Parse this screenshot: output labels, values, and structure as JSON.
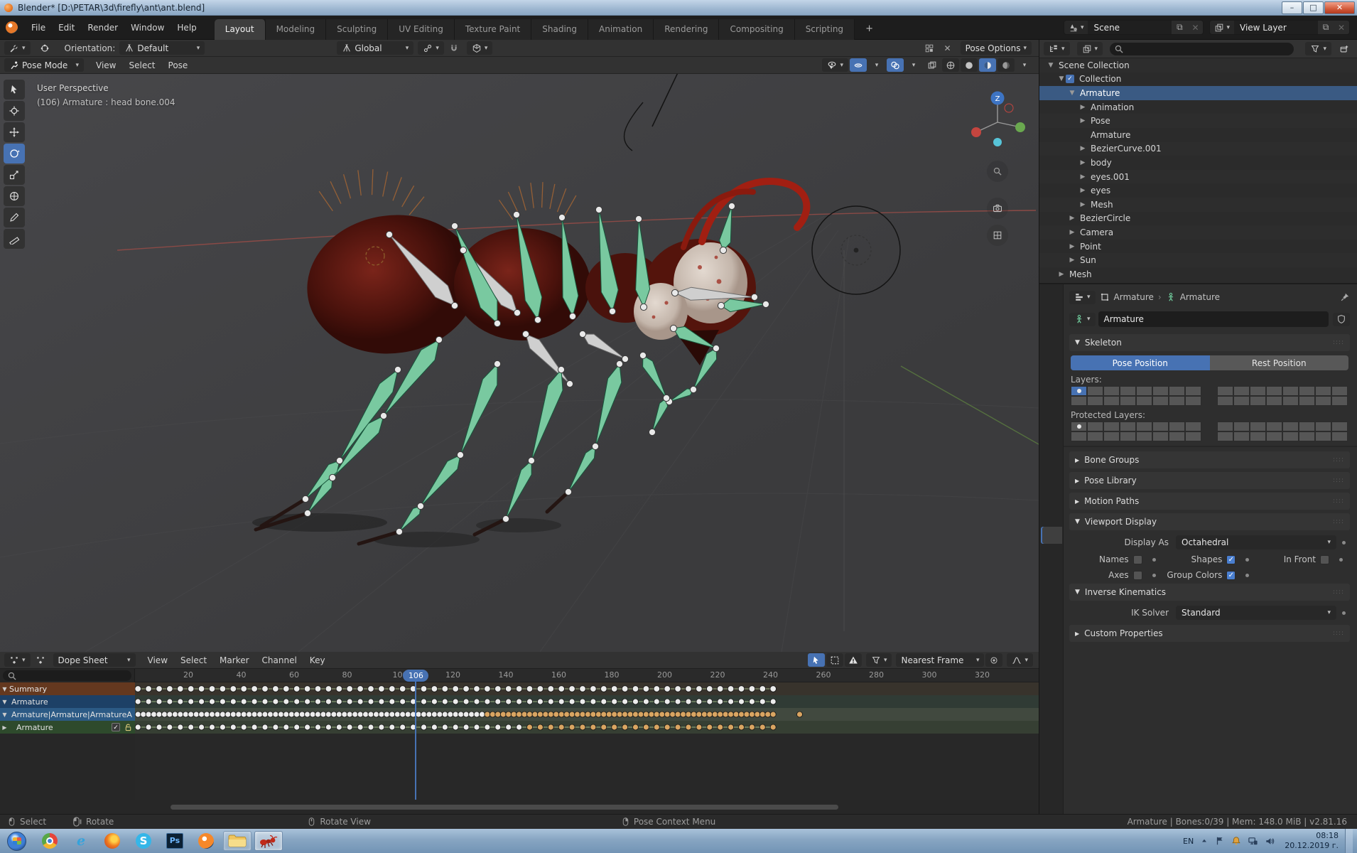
{
  "window": {
    "title": "Blender* [D:\\PETAR\\3d\\firefly\\ant\\ant.blend]"
  },
  "topbar": {
    "menus": [
      "File",
      "Edit",
      "Render",
      "Window",
      "Help"
    ],
    "tabs": [
      {
        "label": "Layout",
        "active": true
      },
      {
        "label": "Modeling"
      },
      {
        "label": "Sculpting"
      },
      {
        "label": "UV Editing"
      },
      {
        "label": "Texture Paint"
      },
      {
        "label": "Shading"
      },
      {
        "label": "Animation"
      },
      {
        "label": "Rendering"
      },
      {
        "label": "Compositing"
      },
      {
        "label": "Scripting"
      }
    ],
    "new_workspace_label": "+",
    "scene_selector": "Scene",
    "view_layer_selector": "View Layer"
  },
  "tool_settings": {
    "orientation_label": "Orientation:",
    "orientation_value": "Default",
    "transform_space": "Global",
    "mode_options_label": "Pose Options"
  },
  "viewport": {
    "mode": "Pose Mode",
    "menus": [
      "View",
      "Select",
      "Pose"
    ],
    "overlay_line1": "User Perspective",
    "overlay_line2": "(106) Armature : head bone.004",
    "gizmo_axis_label": "Z"
  },
  "outliner": {
    "rows": [
      {
        "label": "Scene Collection",
        "depth": 0,
        "icon": "collection",
        "expander": "open"
      },
      {
        "label": "Collection",
        "depth": 1,
        "icon": "collection",
        "checkbox": true,
        "expander": "open",
        "vis": true
      },
      {
        "label": "Armature",
        "depth": 2,
        "icon": "armature-object",
        "selected": true,
        "expander": "open",
        "vis": true
      },
      {
        "label": "Animation",
        "depth": 3,
        "icon": "animation",
        "extra": [
          "action"
        ],
        "expander": "closed"
      },
      {
        "label": "Pose",
        "depth": 3,
        "icon": "pose",
        "extra": [
          "bone"
        ],
        "expander": "closed"
      },
      {
        "label": "Armature",
        "depth": 3,
        "icon": "armature-data"
      },
      {
        "label": "BezierCurve.001",
        "depth": 3,
        "icon": "curve-object",
        "extra": [
          "wrench",
          "material",
          "triangulate"
        ],
        "expander": "closed",
        "vis": true
      },
      {
        "label": "body",
        "depth": 3,
        "icon": "curve-object",
        "extra": [
          "wrench",
          "material",
          "triangulate"
        ],
        "expander": "closed",
        "vis": true
      },
      {
        "label": "eyes.001",
        "depth": 3,
        "icon": "curve-object",
        "extra": [
          "wrench",
          "material",
          "triangulate"
        ],
        "expander": "closed",
        "vis": true
      },
      {
        "label": "eyes",
        "depth": 3,
        "icon": "curve-object",
        "extra": [
          "wrench",
          "material",
          "triangulate"
        ],
        "expander": "closed",
        "vis": true
      },
      {
        "label": "Mesh",
        "depth": 3,
        "icon": "curve-object",
        "extra": [
          "wrench",
          "material",
          "triangulate"
        ],
        "expander": "closed",
        "vis": true
      },
      {
        "label": "BezierCircle",
        "depth": 2,
        "icon": "curve-circle",
        "extra": [
          "bezier-data"
        ],
        "expander": "closed",
        "vis": true
      },
      {
        "label": "Camera",
        "depth": 2,
        "icon": "camera-object",
        "extra": [
          "camera-data"
        ],
        "expander": "closed",
        "vis": true
      },
      {
        "label": "Point",
        "depth": 2,
        "icon": "light-object",
        "extra": [
          "light-point"
        ],
        "expander": "closed",
        "vis": true
      },
      {
        "label": "Sun",
        "depth": 2,
        "icon": "light-object",
        "extra": [
          "sun-data"
        ],
        "expander": "closed",
        "vis": true
      },
      {
        "label": "Mesh",
        "depth": 1,
        "icon": "curve-object",
        "extra": [
          "wrench",
          "material",
          "triangulate"
        ],
        "expander": "closed",
        "vis": true
      }
    ]
  },
  "properties": {
    "tabs": [
      "tool",
      "render",
      "output",
      "view-layer",
      "scene",
      "world",
      "object",
      "constraints",
      "physics",
      "object-data",
      "bone",
      "modifier",
      "texture"
    ],
    "active_tab": "object-data",
    "breadcrumb_1": "Armature",
    "breadcrumb_2": "Armature",
    "name_value": "Armature",
    "skeleton": {
      "title": "Skeleton",
      "pose_button": "Pose Position",
      "rest_button": "Rest Position",
      "layers_label": "Layers:",
      "protected_label": "Protected Layers:"
    },
    "collapsed_sections": [
      "Bone Groups",
      "Pose Library",
      "Motion Paths"
    ],
    "viewport_display": {
      "title": "Viewport Display",
      "display_as_label": "Display As",
      "display_as_value": "Octahedral",
      "toggles": [
        {
          "label": "Names",
          "checked": false
        },
        {
          "label": "Shapes",
          "checked": true
        },
        {
          "label": "In Front",
          "checked": false
        },
        {
          "label": "Axes",
          "checked": false
        },
        {
          "label": "Group Colors",
          "checked": true
        }
      ]
    },
    "inverse_kinematics": {
      "title": "Inverse Kinematics",
      "solver_label": "IK Solver",
      "solver_value": "Standard"
    },
    "custom_properties_title": "Custom Properties"
  },
  "dopesheet": {
    "editor_label": "Dope Sheet",
    "menus": [
      "View",
      "Select",
      "Marker",
      "Channel",
      "Key"
    ],
    "snap_value": "Nearest Frame",
    "current_frame": 106,
    "ruler_ticks": [
      20,
      40,
      60,
      80,
      100,
      120,
      140,
      160,
      180,
      200,
      220,
      240,
      260,
      280,
      300,
      320
    ],
    "channels": [
      {
        "label": "Summary",
        "color": "#64381f",
        "band": "#38332c",
        "expander": "open",
        "keys": {
          "from": 1,
          "to": 241,
          "step": 4
        }
      },
      {
        "label": "Armature",
        "color": "#1d4066",
        "band": "#303b35",
        "icon": "armature-data-w",
        "expander": "open",
        "keys": {
          "from": 1,
          "to": 241,
          "step": 4
        }
      },
      {
        "label": "Armature|Armature|ArmatureA",
        "color": "#2c5a85",
        "band": "#41493f",
        "icon": "action",
        "expander": "open",
        "keys": {
          "from": 1,
          "to": 241,
          "step": 2,
          "tan_from": 133,
          "extra": [
            251
          ]
        }
      },
      {
        "label": "Armature",
        "color": "#2e4a2c",
        "band": "#363f33",
        "expander": "closed",
        "icons": [
          "wrench-w",
          "checkbox",
          "unlock"
        ],
        "keys": {
          "from": 1,
          "to": 241,
          "step": 4,
          "tan_from": 149
        }
      }
    ]
  },
  "statusbar": {
    "hints": [
      {
        "icon": "mouse-left",
        "label": "Select"
      },
      {
        "icon": "mouse-left-drag",
        "label": "Rotate"
      },
      {
        "icon": "mouse-middle",
        "label": "Rotate View"
      },
      {
        "icon": "mouse-right",
        "label": "Pose Context Menu"
      }
    ],
    "info": "Armature | Bones:0/39  | Mem: 148.0 MiB | v2.81.16"
  },
  "taskbar": {
    "apps": [
      {
        "name": "chrome"
      },
      {
        "name": "internet-explorer"
      },
      {
        "name": "firefox"
      },
      {
        "name": "skype"
      },
      {
        "name": "photoshop"
      },
      {
        "name": "blender"
      },
      {
        "name": "folder",
        "open": true
      },
      {
        "name": "ant-blend",
        "active": true
      }
    ],
    "tray": {
      "lang": "EN",
      "time": "08:18",
      "date": "20.12.2019 г."
    }
  }
}
